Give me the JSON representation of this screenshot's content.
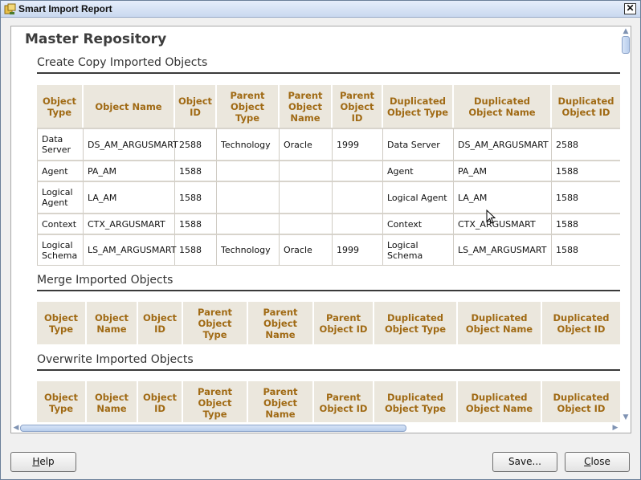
{
  "window": {
    "title": "Smart Import Report",
    "close_glyph": "✕",
    "icon": "smart-import-icon"
  },
  "report": {
    "repository_title": "Master Repository",
    "sections": [
      {
        "title": "Create Copy Imported Objects",
        "headers": [
          "Object Type",
          "Object Name",
          "Object ID",
          "Parent Object Type",
          "Parent Object Name",
          "Parent Object ID",
          "Duplicated Object Type",
          "Duplicated Object Name",
          "Duplicated Object ID"
        ],
        "rows": [
          [
            "Data Server",
            "DS_AM_ARGUSMART",
            "2588",
            "Technology",
            "Oracle",
            "1999",
            "Data Server",
            "DS_AM_ARGUSMART",
            "2588"
          ],
          [
            "Agent",
            "PA_AM",
            "1588",
            "",
            "",
            "",
            "Agent",
            "PA_AM",
            "1588"
          ],
          [
            "Logical Agent",
            "LA_AM",
            "1588",
            "",
            "",
            "",
            "Logical Agent",
            "LA_AM",
            "1588"
          ],
          [
            "Context",
            "CTX_ARGUSMART",
            "1588",
            "",
            "",
            "",
            "Context",
            "CTX_ARGUSMART",
            "1588"
          ],
          [
            "Logical Schema",
            "LS_AM_ARGUSMART",
            "1588",
            "Technology",
            "Oracle",
            "1999",
            "Logical Schema",
            "LS_AM_ARGUSMART",
            "1588"
          ]
        ]
      },
      {
        "title": "Merge Imported Objects",
        "headers": [
          "Object Type",
          "Object Name",
          "Object ID",
          "Parent Object Type",
          "Parent Object Name",
          "Parent Object ID",
          "Duplicated Object Type",
          "Duplicated Object Name",
          "Duplicated Object ID"
        ],
        "rows": []
      },
      {
        "title": "Overwrite Imported Objects",
        "headers": [
          "Object Type",
          "Object Name",
          "Object ID",
          "Parent Object Type",
          "Parent Object Name",
          "Parent Object ID",
          "Duplicated Object Type",
          "Duplicated Object Name",
          "Duplicated Object ID"
        ],
        "rows": []
      }
    ]
  },
  "buttons": {
    "help": {
      "mnemonic": "H",
      "rest": "elp"
    },
    "save": {
      "label": "Save..."
    },
    "close": {
      "mnemonic": "C",
      "rest": "lose"
    }
  },
  "scrollbars": {
    "up_arrow": "▲",
    "down_arrow": "▼",
    "left_arrow": "◀",
    "right_arrow": "▶"
  },
  "colors": {
    "header_bg": "#ebe7dd",
    "header_text": "#a06a14",
    "title_bar": "#c9d8ef"
  }
}
